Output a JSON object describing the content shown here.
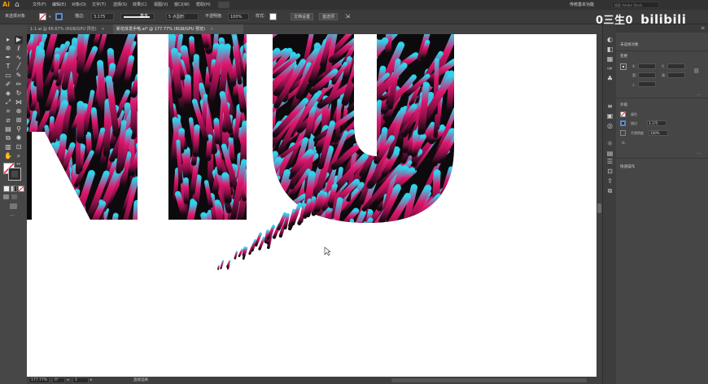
{
  "app": {
    "logo": "Ai",
    "home_icon": "home-icon"
  },
  "menu": [
    "文件(F)",
    "编辑(E)",
    "对象(O)",
    "文字(T)",
    "选择(S)",
    "效果(C)",
    "视图(V)",
    "窗口(W)",
    "帮助(H)"
  ],
  "workspace": {
    "label": "传统基本功能"
  },
  "search": {
    "placeholder": "搜索 Adobe Stock"
  },
  "watermark": {
    "left": "0三生0",
    "right": "bilibili"
  },
  "control_bar": {
    "selection_label": "未选择对象",
    "stroke_label": "描边:",
    "stroke_value": "3.175",
    "brush_label": "基本",
    "profile_label": "5 点圆形",
    "opacity_label": "不透明度:",
    "opacity_value": "100%",
    "style_label": "样式:",
    "doc_setup": "文档设置",
    "preferences": "首选项"
  },
  "tabs": [
    {
      "label": "1-1.ai @ 66.67% (RGB/GPU 预览)",
      "active": false
    },
    {
      "label": "新花体发手咯.ai* @ 177.77% (RGB/GPU 预览)",
      "active": true
    }
  ],
  "status": {
    "zoom": "177.77%",
    "rotation": "0°",
    "page": "1",
    "tool": "直接选择"
  },
  "properties": {
    "no_selection": "未选择对象",
    "transform_title": "变换",
    "x_label": "X:",
    "y_label": "Y:",
    "w_label": "宽:",
    "h_label": "高:",
    "angle_label": "△",
    "appearance_title": "外观",
    "fill_label": "填色",
    "stroke_label": "描边",
    "stroke_value": "3.175",
    "opacity_label": "不透明度",
    "opacity_value": "100%",
    "fx_label": "fx.",
    "quick_actions": "快速操作"
  },
  "colors": {
    "accent_pink": "#e0186e",
    "accent_cyan": "#30d6ee",
    "accent_dark": "#1a0f16"
  }
}
